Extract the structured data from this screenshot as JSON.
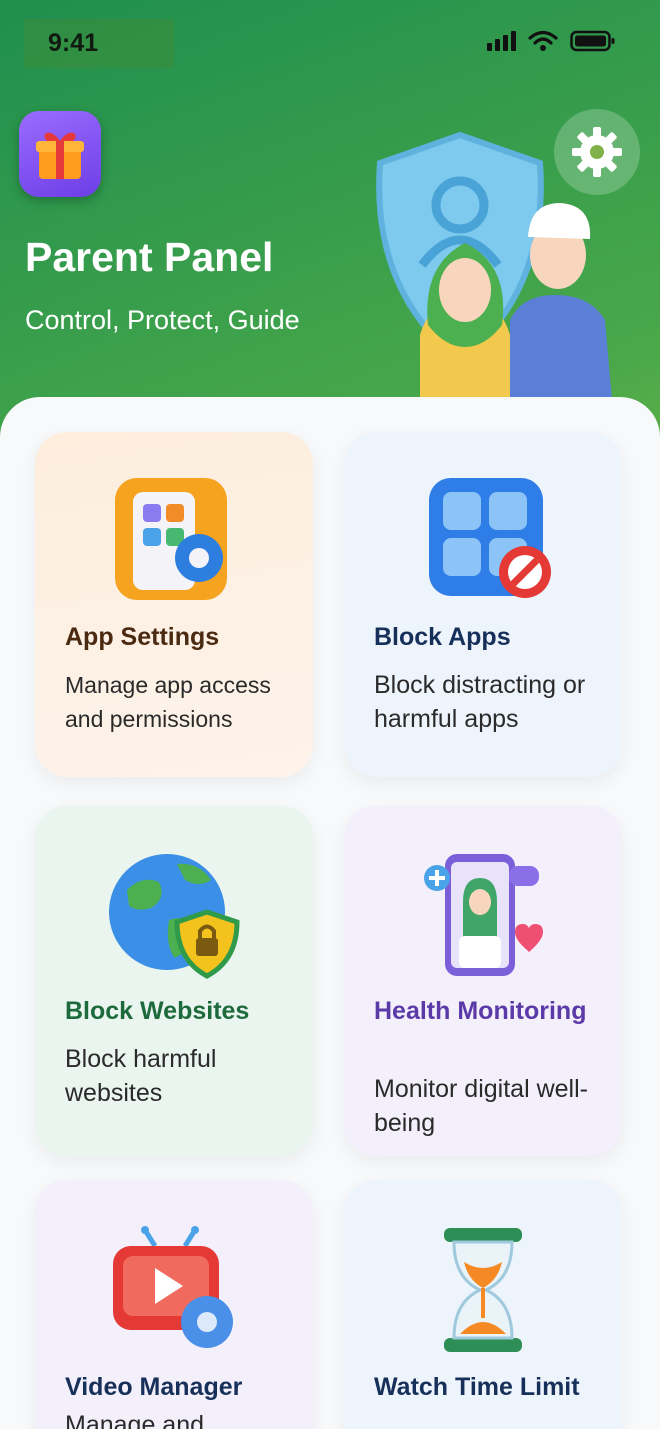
{
  "status_bar": {
    "time": "9:41"
  },
  "header": {
    "title": "Parent Panel",
    "subtitle": "Control, Protect, Guide",
    "gift_icon": "gift-icon",
    "settings_icon": "gear-icon"
  },
  "cards": [
    {
      "title": "App Settings",
      "description": "Manage app access and permissions",
      "icon": "app-settings-icon",
      "title_color": "#4a2a10",
      "bg": "orange"
    },
    {
      "title": "Block Apps",
      "description": "Block distracting or harmful apps",
      "icon": "block-apps-icon",
      "title_color": "#16305a",
      "bg": "blue"
    },
    {
      "title": "Block Websites",
      "description": "Block harmful websites",
      "icon": "globe-lock-icon",
      "title_color": "#1d6b3c",
      "bg": "green"
    },
    {
      "title": "Health Monitoring",
      "description": "Monitor digital well-being",
      "icon": "health-monitor-icon",
      "title_color": "#5b3aa8",
      "bg": "purple"
    },
    {
      "title": "Video Manager",
      "description": "Manage and",
      "icon": "video-manager-icon",
      "title_color": "#16305a",
      "bg": "purple"
    },
    {
      "title": "Watch Time Limit",
      "description": "",
      "icon": "hourglass-icon",
      "title_color": "#16305a",
      "bg": "blue"
    }
  ]
}
